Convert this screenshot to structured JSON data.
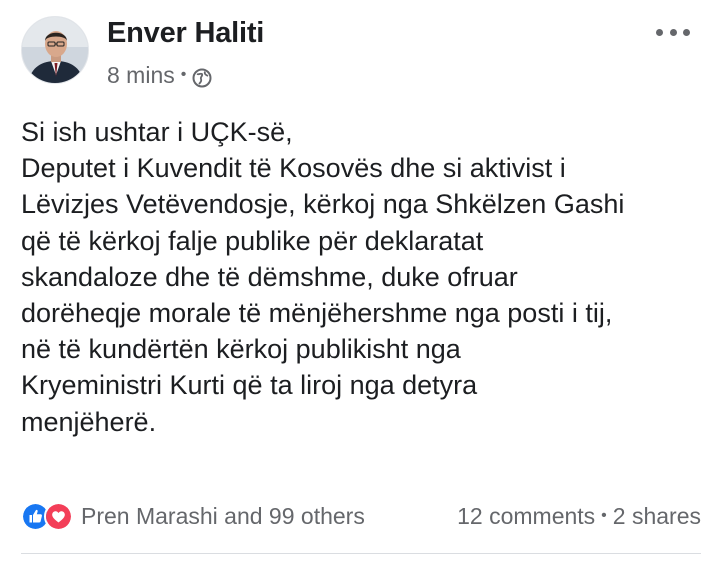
{
  "post": {
    "author": "Enver Haliti",
    "time": "8 mins",
    "separator": "•",
    "privacy_icon": "globe-icon",
    "body_lines": [
      "Si ish ushtar i UÇK-së,",
      "Deputet i Kuvendit të Kosovës dhe si aktivist i",
      "Lëvizjes Vetëvendosje, kërkoj nga Shkëlzen Gashi",
      "që të kërkoj falje publike për deklaratat",
      "skandaloze dhe të dëmshme, duke ofruar",
      "dorëheqje morale të mënjëhershme nga posti i tij,",
      "në të kundërtën kërkoj publikisht nga",
      "Kryeministri Kurti që ta liroj nga detyra",
      "menjëherë."
    ]
  },
  "footer": {
    "reaction_icons": [
      "like-icon",
      "love-icon"
    ],
    "reactors": "Pren Marashi and 99 others",
    "comments": "12 comments",
    "separator": "•",
    "shares": "2 shares"
  },
  "colors": {
    "text": "#1c1e21",
    "secondary": "#65676b",
    "like_blue": "#1877f2",
    "love_red": "#f33e58"
  }
}
